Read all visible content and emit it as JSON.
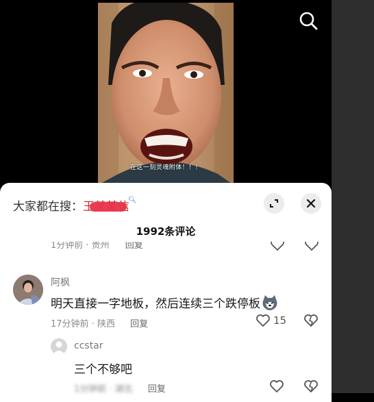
{
  "video": {
    "subtitle": "在这一刻灵魂附体！！！"
  },
  "search_suggestion": {
    "prefix": "大家都在搜：",
    "term": "王某某信"
  },
  "comments_header": {
    "count_label": "1992条评论"
  },
  "comments": [
    {
      "meta": "1分钟前 · 贵州",
      "reply_label": "回复"
    },
    {
      "username": "阿枫",
      "text": "明天直接一字地板，然后连续三个跌停板",
      "emoji": "cat-face-emoji",
      "meta": "17分钟前 · 陕西",
      "reply_label": "回复",
      "likes": "15"
    },
    {
      "username": "ccstar",
      "text": "三个不够吧",
      "meta": "1分钟前 · 湖北",
      "reply_label": "回复"
    }
  ],
  "icons": {
    "search": "search-icon",
    "expand": "expand-icon",
    "close": "close-icon",
    "like": "heart-icon",
    "dislike": "broken-heart-icon"
  }
}
